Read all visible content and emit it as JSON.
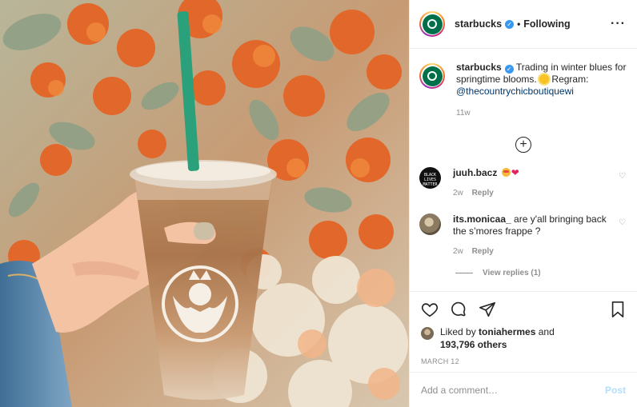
{
  "post": {
    "image_alt": "Hand holding a Starbucks iced coffee in front of orange and white flowers",
    "owner": {
      "username": "starbucks",
      "verified": true,
      "follow_status": "Following"
    },
    "caption": {
      "username": "starbucks",
      "text": "Trading in winter blues for springtime blooms.",
      "regram_label": "Regram:",
      "mention": "@thecountrychicboutiquewi",
      "time_ago": "11w"
    },
    "comments": [
      {
        "username": "juuh.bacz",
        "text": "",
        "avatar_text": "BLACK LIVES MATTER",
        "time_ago": "2w",
        "reply_label": "Reply"
      },
      {
        "username": "its.monicaa_",
        "text": "are y'all bringing back the s’mores frappe ?",
        "time_ago": "2w",
        "reply_label": "Reply",
        "view_replies": "View replies (1)"
      }
    ],
    "likes": {
      "prefix": "Liked by",
      "liker": "toniahermes",
      "connector": "and",
      "others": "193,796 others"
    },
    "date": "MARCH 12",
    "add_comment": {
      "placeholder": "Add a comment…",
      "post_label": "Post"
    }
  },
  "colors": {
    "accent_blue": "#3897f0",
    "mention": "#00376b",
    "post_disabled": "#b2dffc",
    "starbucks_green": "#00704a"
  },
  "icons": {
    "more": "more-options-icon",
    "load_more": "plus-circle-icon",
    "like": "heart-icon",
    "comment": "comment-bubble-icon",
    "share": "paper-plane-icon",
    "save": "bookmark-icon"
  }
}
